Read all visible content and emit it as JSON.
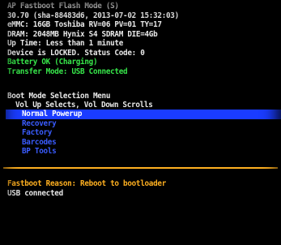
{
  "header": {
    "mode_title": "AP Fastboot Flash Mode (S)",
    "build_info": "30.70 (sha-88483d6, 2013-07-02 15:32:03)",
    "emmc": "eMMC: 16GB Toshiba RV=06 PV=01 TY=17",
    "dram": "DRAM: 2048MB Hynix S4 SDRAM DIE=4Gb",
    "uptime": "Up Time: Less than 1 minute",
    "lock_status": "Device is LOCKED.  Status Code: 0",
    "battery": "Battery OK (Charging)",
    "transfer": "Transfer Mode: USB Connected"
  },
  "menu": {
    "title": "Boot Mode Selection Menu",
    "hint": "Vol Up Selects, Vol Down Scrolls",
    "items": [
      {
        "label": "Normal Powerup",
        "selected": true
      },
      {
        "label": "Recovery",
        "selected": false
      },
      {
        "label": "Factory",
        "selected": false
      },
      {
        "label": "Barcodes",
        "selected": false
      },
      {
        "label": "BP Tools",
        "selected": false
      }
    ]
  },
  "footer": {
    "reason": "Fastboot Reason: Reboot to bootloader",
    "usb": "USB connected"
  },
  "colors": {
    "text": "#e8e8e8",
    "status_green": "#37e64a",
    "menu_blue": "#3a5cff",
    "highlight": "#1a3cff",
    "divider_orange": "#ffb020"
  }
}
